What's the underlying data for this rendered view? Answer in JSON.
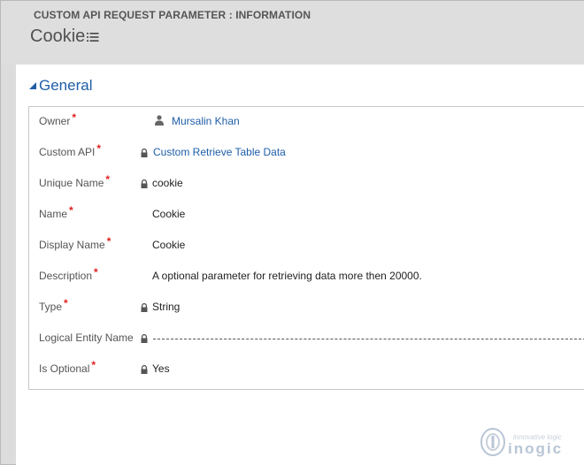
{
  "header": {
    "entity_type": "CUSTOM API REQUEST PARAMETER : INFORMATION",
    "record_title": "Cookie",
    "title_menu_icon": "list-menu-icon"
  },
  "section": {
    "title": "General",
    "collapse_icon": "triangle-collapse-icon"
  },
  "fields": [
    {
      "label": "Owner",
      "required": "*",
      "value": "Mursalin Khan",
      "icon": "user-icon",
      "locked": false,
      "link": true
    },
    {
      "label": "Custom API",
      "required": "*",
      "value": "Custom Retrieve Table Data",
      "icon": "lock-icon",
      "locked": true,
      "link": true
    },
    {
      "label": "Unique Name",
      "required": "*",
      "value": "cookie",
      "icon": "lock-icon",
      "locked": true,
      "link": false
    },
    {
      "label": "Name",
      "required": "*",
      "value": "Cookie",
      "locked": false,
      "link": false
    },
    {
      "label": "Display Name",
      "required": "*",
      "value": "Cookie",
      "locked": false,
      "link": false
    },
    {
      "label": "Description",
      "required": "*",
      "value": "A optional parameter for retrieving data more then 20000.",
      "locked": false,
      "link": false
    },
    {
      "label": "Type",
      "required": "*",
      "value": "String",
      "icon": "lock-icon",
      "locked": true,
      "link": false
    },
    {
      "label": "Logical Entity Name",
      "required": "",
      "value": "",
      "icon": "lock-icon",
      "locked": true,
      "link": false
    },
    {
      "label": "Is Optional",
      "required": "*",
      "value": "Yes",
      "icon": "lock-icon",
      "locked": true,
      "link": false
    }
  ],
  "watermark": {
    "tagline": "innovative logic",
    "brand": "inogic"
  },
  "colors": {
    "accent": "#1f5ea8",
    "required": "#e02020",
    "header_bg": "#dedede"
  }
}
